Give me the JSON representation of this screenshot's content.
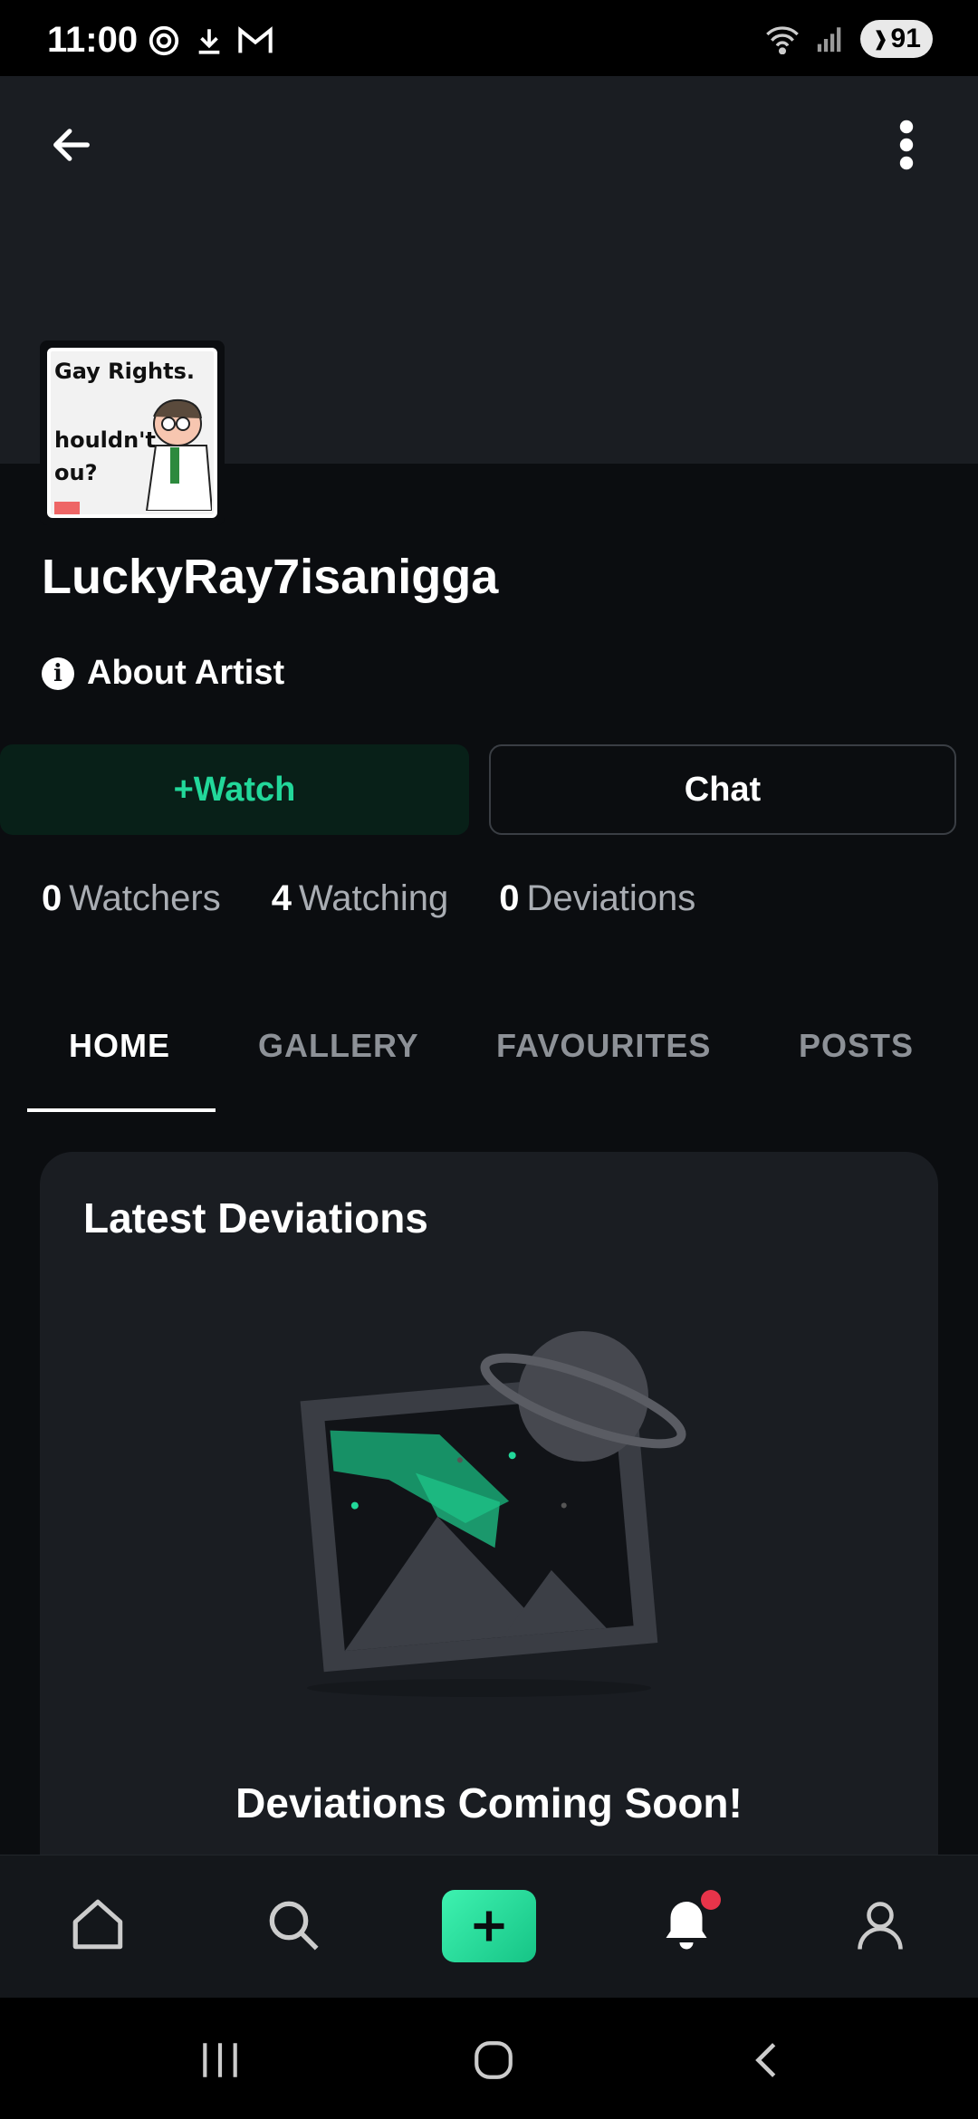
{
  "status_bar": {
    "time": "11:00",
    "battery": "91",
    "icons_left": [
      "at-sign-icon",
      "download-icon",
      "gmail-icon"
    ],
    "icons_right": [
      "wifi-icon",
      "signal-icon",
      "battery-icon"
    ]
  },
  "header": {
    "back_icon": "arrow-left-icon",
    "more_icon": "more-vertical-icon"
  },
  "profile": {
    "avatar_lines": [
      "Gay Rights.",
      "houldn't",
      "ou?"
    ],
    "username": "LuckyRay7isanigga",
    "about_label": "About Artist"
  },
  "actions": {
    "watch_label": "+Watch",
    "chat_label": "Chat"
  },
  "stats": [
    {
      "count": "0",
      "label": "Watchers"
    },
    {
      "count": "4",
      "label": "Watching"
    },
    {
      "count": "0",
      "label": "Deviations"
    }
  ],
  "tabs": [
    {
      "label": "HOME",
      "active": true
    },
    {
      "label": "GALLERY",
      "active": false
    },
    {
      "label": "FAVOURITES",
      "active": false
    },
    {
      "label": "POSTS",
      "active": false
    }
  ],
  "latest": {
    "title": "Latest Deviations",
    "empty_message": "Deviations Coming Soon!"
  },
  "bottom_nav": [
    "home-icon",
    "search-icon",
    "create-icon",
    "notifications-icon",
    "profile-icon"
  ],
  "colors": {
    "accent": "#22d89a",
    "background": "#0b0d10",
    "card": "#1a1d22",
    "notification_dot": "#e8344a"
  }
}
